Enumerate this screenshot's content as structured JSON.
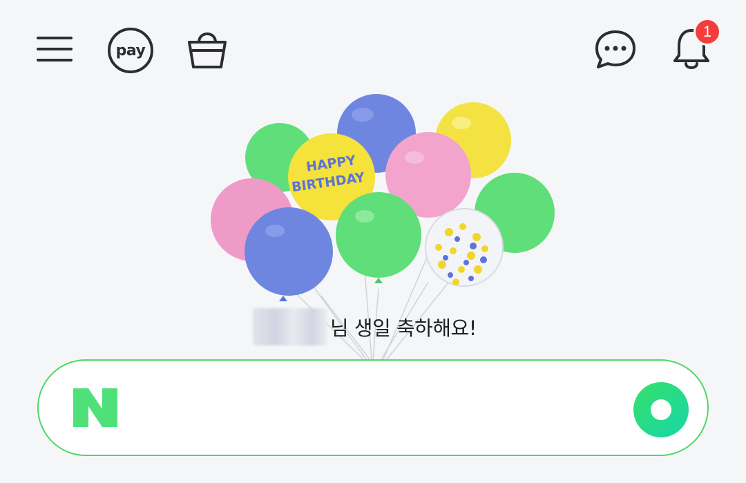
{
  "header": {
    "pay_label": "pay",
    "notification_count": "1"
  },
  "greeting": {
    "message": "님 생일 축하해요!",
    "balloon_text_line1": "HAPPY",
    "balloon_text_line2": "BIRTHDAY"
  },
  "search": {
    "logo_letter": "N",
    "placeholder": ""
  },
  "colors": {
    "accent_green": "#03c75a",
    "badge_red": "#f53c3c",
    "icon_dark": "#2b2d31"
  },
  "icons": [
    "menu-icon",
    "pay-icon",
    "shopping-bag-icon",
    "chat-icon",
    "bell-icon",
    "naver-logo-icon",
    "green-lens-icon"
  ]
}
